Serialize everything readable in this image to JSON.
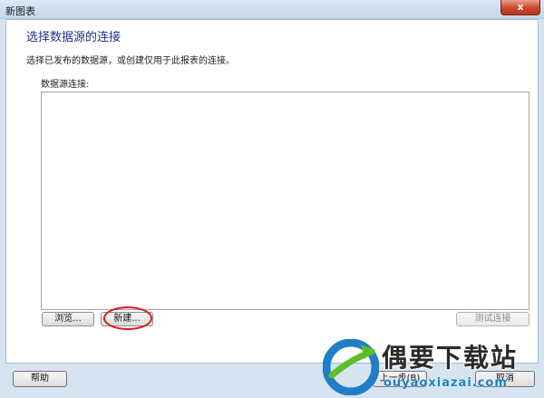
{
  "window": {
    "title": "新图表",
    "close_label": "x"
  },
  "page": {
    "heading": "选择数据源的连接",
    "description": "选择已发布的数据源，或创建仅用于此报表的连接。",
    "list_label": "数据源连接:"
  },
  "buttons": {
    "browse": "浏览...",
    "new": "新建...",
    "test_connection": "测试连接"
  },
  "footer": {
    "help": "帮助",
    "back": "上一步(B)",
    "cancel": "取消"
  },
  "watermark": {
    "brand": "偶要下载站",
    "url": "ouyaoxiazai.com",
    "logo_icon": "ouyao-logo-icon"
  },
  "colors": {
    "heading": "#1e3287",
    "highlight": "#d81d1d",
    "close_button": "#c9462c"
  }
}
